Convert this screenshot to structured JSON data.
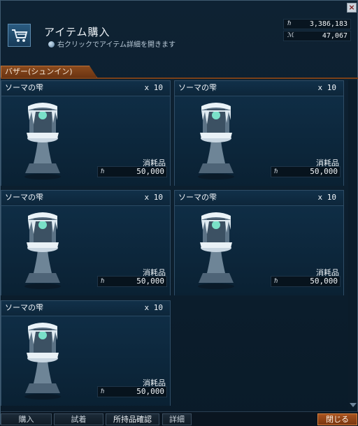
{
  "header": {
    "title": "アイテム購入",
    "hint": "右クリックでアイテム詳細を開きます"
  },
  "currency": {
    "gold_symbol": "ℏ",
    "gold_amount": "3,386,183",
    "points_symbol": "ℳ",
    "points_amount": "47,067"
  },
  "tab": {
    "label": "バザー(シュンイン)"
  },
  "items": [
    {
      "name": "ソーマの雫",
      "qty": "x 10",
      "kind": "消耗品",
      "price_symbol": "ℏ",
      "price": "50,000"
    },
    {
      "name": "ソーマの雫",
      "qty": "x 10",
      "kind": "消耗品",
      "price_symbol": "ℏ",
      "price": "50,000"
    },
    {
      "name": "ソーマの雫",
      "qty": "x 10",
      "kind": "消耗品",
      "price_symbol": "ℏ",
      "price": "50,000"
    },
    {
      "name": "ソーマの雫",
      "qty": "x 10",
      "kind": "消耗品",
      "price_symbol": "ℏ",
      "price": "50,000"
    },
    {
      "name": "ソーマの雫",
      "qty": "x 10",
      "kind": "消耗品",
      "price_symbol": "ℏ",
      "price": "50,000"
    }
  ],
  "buttons": {
    "buy": "購入",
    "try_on": "試着",
    "owned_check": "所持品確認",
    "details": "詳細",
    "close": "閉じる"
  },
  "icons": {
    "window_close": "close-icon",
    "cart": "cart-icon",
    "item": "soma-drop-icon"
  },
  "colors": {
    "accent_orange": "#8a4a1d",
    "panel_blue": "#0f2d45"
  }
}
